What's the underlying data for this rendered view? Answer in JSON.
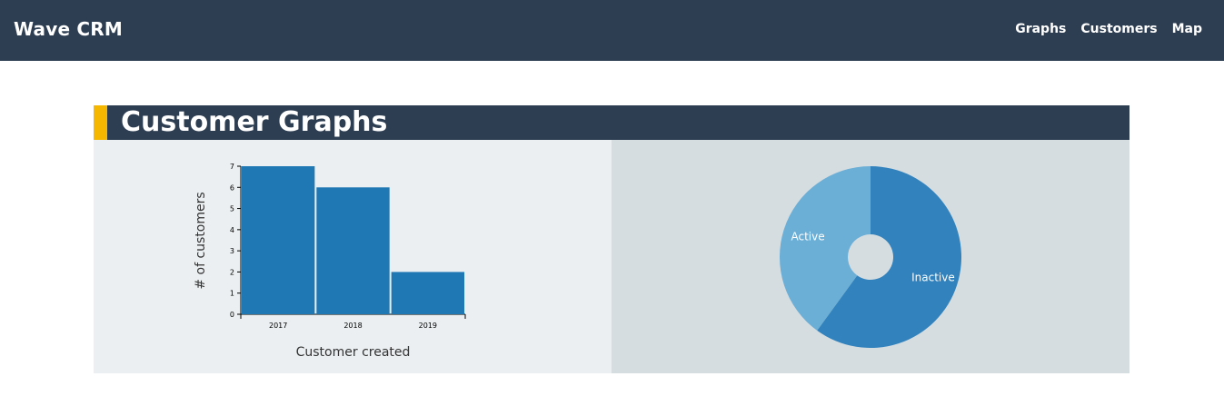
{
  "app": {
    "brand": "Wave CRM"
  },
  "nav": {
    "links": [
      "Graphs",
      "Customers",
      "Map"
    ]
  },
  "section": {
    "title": "Customer Graphs"
  },
  "colors": {
    "navbar": "#2e3e52",
    "accent": "#f6b700",
    "bar": "#1f77b4",
    "pie_inactive": "#3182bd",
    "pie_active": "#6baed6"
  },
  "chart_data": [
    {
      "type": "bar",
      "categories": [
        "2017",
        "2018",
        "2019"
      ],
      "values": [
        7,
        6,
        2
      ],
      "xlabel": "Customer created",
      "ylabel": "# of customers",
      "ylim": [
        0,
        7
      ],
      "yticks": [
        "0",
        "1",
        "2",
        "3",
        "4",
        "5",
        "6",
        "7"
      ]
    },
    {
      "type": "pie",
      "labels": [
        "Inactive",
        "Active"
      ],
      "values": [
        0.6,
        0.4
      ],
      "donut": true
    }
  ]
}
